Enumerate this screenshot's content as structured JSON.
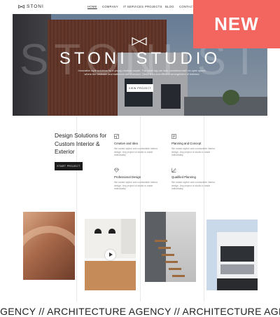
{
  "brand": {
    "logo_text": "STONI"
  },
  "nav": {
    "items": [
      {
        "label": "HOME",
        "active": true
      },
      {
        "label": "COMPANY",
        "active": false
      },
      {
        "label": "IT SERVICES",
        "active": false
      },
      {
        "label": "PROJECTS",
        "active": false
      },
      {
        "label": "BLOG",
        "active": false
      },
      {
        "label": "CONTACTS",
        "active": false
      }
    ]
  },
  "badge": {
    "label": "NEW",
    "color": "#f2665f"
  },
  "hero": {
    "title": "STONI STUDIO",
    "ghost_text": "STONI STUDIO",
    "tagline": "Innovative style solutions for a young creative couple. The small lag can was considered with an open space, where the bedroom and bathroom are enclosed. Clean lines and efficient arrangement of interiors.",
    "cta_label": "VIEW PROJECT"
  },
  "solutions": {
    "title": "Design Solutions for Custom Interior & Exterior",
    "button_label": "START PROJECT"
  },
  "features": [
    {
      "icon": "blueprint-icon",
      "title": "Creative and Idea",
      "desc": "We create stylish and comfortable interior design. Any project of studio is made individually."
    },
    {
      "icon": "plan-icon",
      "title": "Planning and Concept",
      "desc": "We create stylish and comfortable interior design. Any project of studio is made individually."
    },
    {
      "icon": "diamond-icon",
      "title": "Professional Design",
      "desc": "We create stylish and comfortable interior design. Any project of studio is made individually."
    },
    {
      "icon": "pencil-ruler-icon",
      "title": "Qualified Planning",
      "desc": "We create stylish and comfortable interior design. Any project of studio is made individually."
    }
  ],
  "marquee": {
    "text": "RE AGENCY  //  ARCHITECTURE AGENCY  //  ARCHITECTURE AGENCY  //  ARCHITECT"
  },
  "colors": {
    "accent": "#f2665f",
    "dark": "#1c1c1c"
  }
}
